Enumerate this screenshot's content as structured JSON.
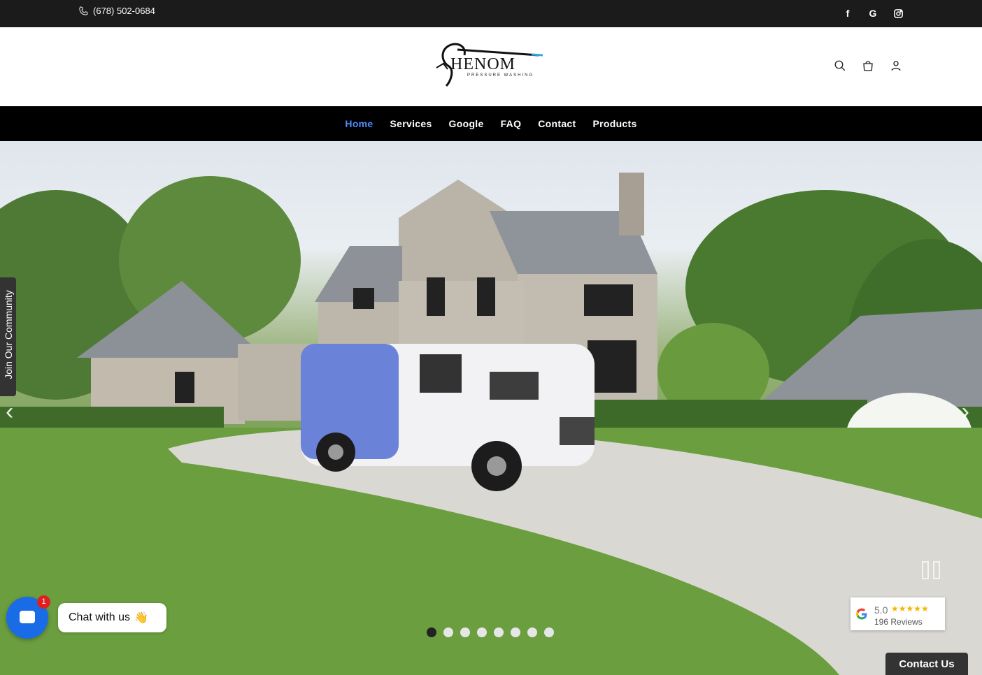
{
  "topbar": {
    "phone": "(678) 502-0684",
    "social": [
      "facebook-icon",
      "google-icon",
      "instagram-icon"
    ]
  },
  "header": {
    "logo_text": "HENOM",
    "logo_subtitle": "PRESSURE WASHING",
    "icons": [
      "search-icon",
      "cart-icon",
      "account-icon"
    ]
  },
  "nav": {
    "items": [
      {
        "label": "Home"
      },
      {
        "label": "Services"
      },
      {
        "label": "Google"
      },
      {
        "label": "FAQ"
      },
      {
        "label": "Contact"
      },
      {
        "label": "Products"
      }
    ],
    "active_color": "#4f8dff"
  },
  "hero": {
    "community_tab": "Join Our Community",
    "slide_count": 8,
    "active_slide": 1
  },
  "chat": {
    "label": "Chat with us",
    "emoji": "👋",
    "badge": "1"
  },
  "review": {
    "score": "5.0",
    "stars": "★★★★★",
    "count": "196 Reviews"
  },
  "contact_tab": "Contact Us",
  "colors": {
    "topbar": "#1b1b1b",
    "nav": "#000000",
    "chat_button": "#1a6ce6"
  }
}
